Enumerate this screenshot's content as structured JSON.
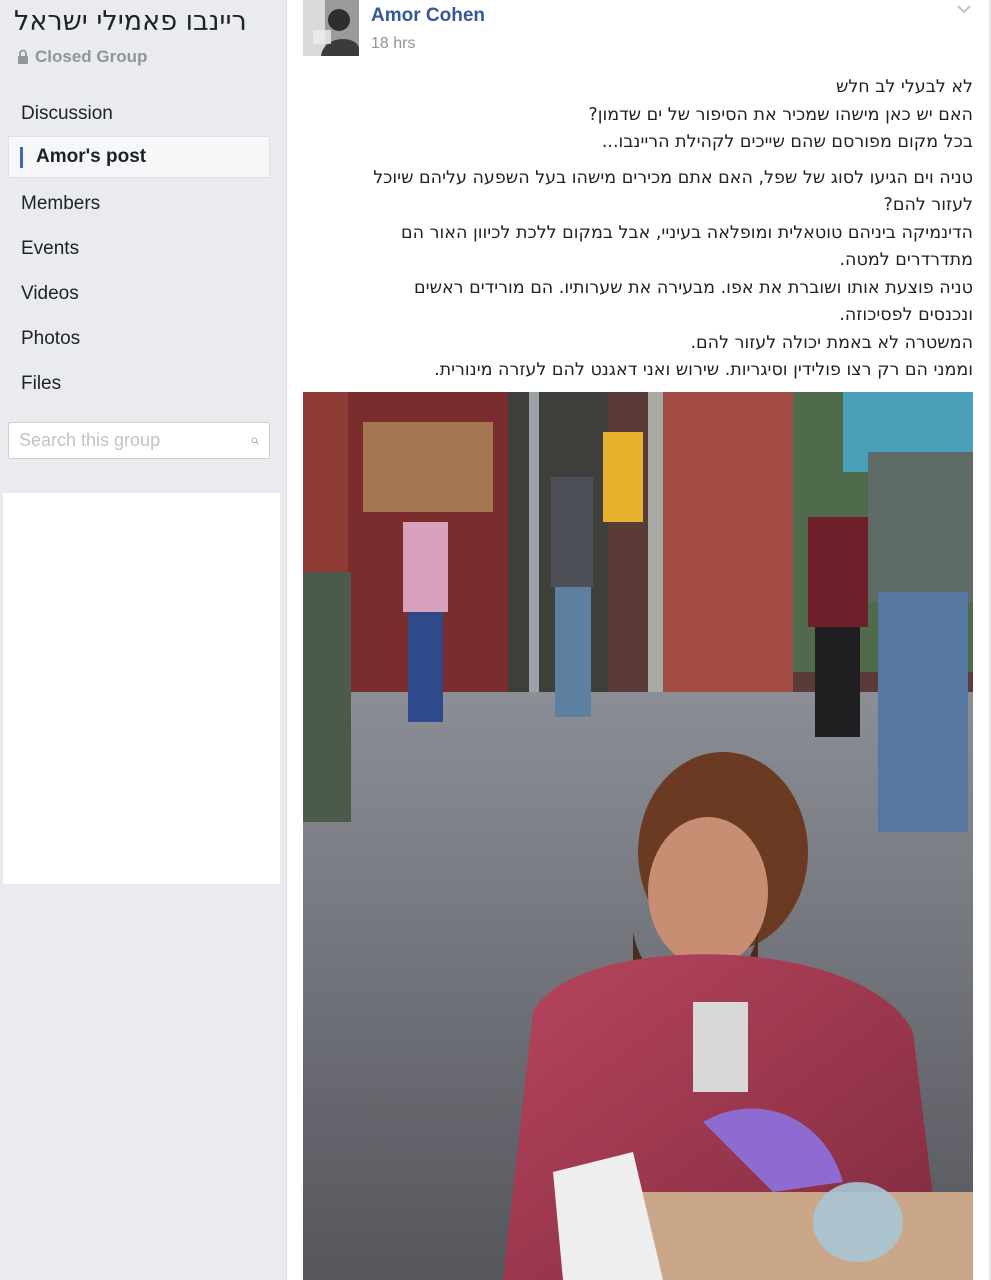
{
  "group": {
    "name": "ריינבו פאמילי ישראל",
    "privacy": "Closed Group"
  },
  "nav": {
    "items": [
      {
        "label": "Discussion"
      },
      {
        "label": "Amor's post"
      },
      {
        "label": "Members"
      },
      {
        "label": "Events"
      },
      {
        "label": "Videos"
      },
      {
        "label": "Photos"
      },
      {
        "label": "Files"
      }
    ],
    "active_index": 1
  },
  "search": {
    "placeholder": "Search this group"
  },
  "post": {
    "author": "Amor Cohen",
    "time": "18 hrs",
    "paragraph1": [
      "לא לבעלי לב חלש",
      "האם יש כאן מישהו שמכיר את הסיפור של ים שדמון?",
      "בכל מקום מפורסם שהם שייכים לקהילת הריינבו..."
    ],
    "paragraph2": [
      "טניה וים הגיעו לסוג של שפל, האם אתם מכירים מישהו בעל השפעה עליהם שיוכל",
      "לעזור להם?",
      "הדינמיקה ביניהם טוטאלית ומופלאה בעיניי, אבל במקום ללכת לכיוון האור הם",
      "מתדרדרים למטה.",
      "טניה פוצעת אותו ושוברת את אפו. מבעירה את שערותיו. הם מורידים ראשים",
      "ונכנסים לפסיכוזה.",
      "המשטרה לא באמת יכולה לעזור להם.",
      "וממני הם רק רצו פולידין וסיגריות. שירוש ואני דאגנט להם לעזרה מינורית."
    ]
  }
}
